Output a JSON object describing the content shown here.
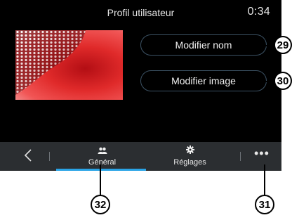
{
  "header": {
    "title": "Profil utilisateur",
    "clock": "0:34"
  },
  "profile": {
    "change_name_label": "Modifier nom",
    "change_image_label": "Modifier image"
  },
  "tabbar": {
    "back_icon": "chevron-left-icon",
    "tabs": [
      {
        "label": "Général",
        "icon": "users-icon",
        "selected": true
      },
      {
        "label": "Réglages",
        "icon": "gear-icon",
        "selected": false
      }
    ],
    "more_label": "•••"
  },
  "callouts": {
    "c29": "29",
    "c30": "30",
    "c31": "31",
    "c32": "32"
  },
  "colors": {
    "accent": "#2aa4e6",
    "tabbar": "#2b2e31",
    "screen": "#000000"
  }
}
